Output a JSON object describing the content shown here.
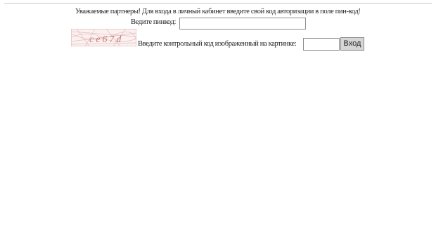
{
  "form": {
    "greeting": "Уважаемые партнеры! Для входа в личный кабинет введите свой код авторизации в поле пин-код!",
    "pin_label": "Ведите пинкод:",
    "pin_value": "",
    "captcha_label": "Введите контрольный код изображенный на картинке:",
    "captcha_text": "ce67d",
    "captcha_color": "#c77b78",
    "code_value": "",
    "login_button": "Вход"
  }
}
